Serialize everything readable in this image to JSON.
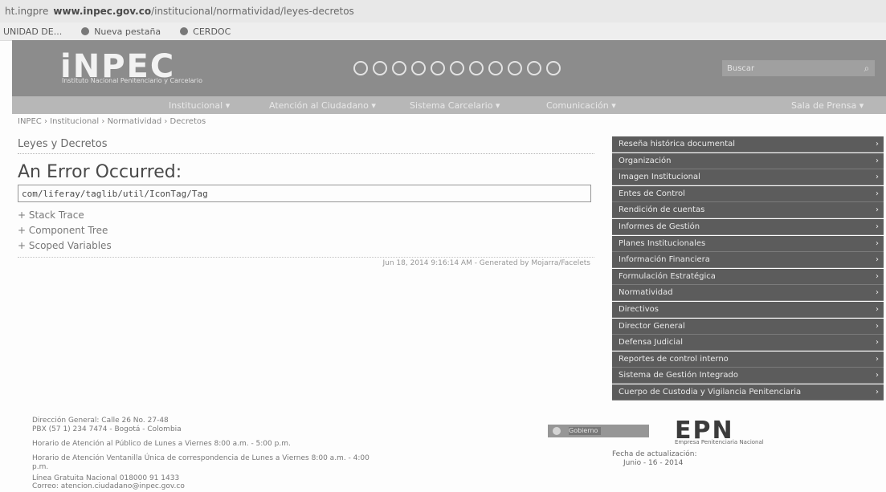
{
  "browser": {
    "url_prefix": "ht.ingpre",
    "url_domain": "www.inpec.gov.co",
    "url_path": "/institucional/normatividad/leyes-decretos"
  },
  "bookmarks": [
    {
      "label": "UNIDAD DE...",
      "icon": "globe-icon"
    },
    {
      "label": "Nueva pestaña",
      "icon": "globe-icon"
    },
    {
      "label": "CERDOC",
      "icon": "globe-icon"
    }
  ],
  "header": {
    "logo": "iNPEC",
    "logo_sub": "Instituto Nacional Penitenciario y Carcelario",
    "social_icons": [
      "circle-icon-1",
      "circle-icon-2",
      "circle-icon-3",
      "circle-icon-4",
      "circle-icon-5",
      "circle-icon-6",
      "circle-icon-7",
      "circle-icon-8",
      "circle-icon-9",
      "circle-icon-10",
      "circle-icon-11"
    ],
    "search_placeholder": "Buscar",
    "search_icon": "search-icon"
  },
  "nav": [
    {
      "label": "Institucional"
    },
    {
      "label": "Atención al Ciudadano"
    },
    {
      "label": "Sistema Carcelario"
    },
    {
      "label": "Comunicación"
    },
    {
      "label": "Sala de Prensa"
    }
  ],
  "breadcrumb": "INPEC › Institucional › Normatividad › Decretos",
  "main": {
    "section_title": "Leyes y Decretos",
    "error_title": "An Error Occurred:",
    "error_message": "com/liferay/taglib/util/IconTag/Tag",
    "toggles": [
      "+ Stack Trace",
      "+ Component Tree",
      "+ Scoped Variables"
    ],
    "version_line": "Jun 18, 2014 9:16:14 AM - Generated by Mojarra/Facelets"
  },
  "sidebar": {
    "items": [
      "Reseña histórica documental",
      "Organización",
      "Imagen Institucional",
      "Entes de Control",
      "Rendición de cuentas",
      "Informes de Gestión",
      "Planes Institucionales",
      "Información Financiera",
      "Formulación Estratégica",
      "Normatividad",
      "Directivos",
      "Director General",
      "Defensa Judicial",
      "Reportes de control interno",
      "Sistema de Gestión Integrado",
      "Cuerpo de Custodia y Vigilancia Penitenciaria"
    ]
  },
  "footer": {
    "line1": "Dirección General: Calle 26 No. 27-48",
    "line2": "PBX (57 1) 234 7474 - Bogotá - Colombia",
    "line3": "Horario de Atención al Público de Lunes a Viernes 8:00 a.m. - 5:00 p.m.",
    "line4": "Horario de Atención Ventanilla Única de correspondencia de Lunes a Viernes 8:00 a.m. - 4:00",
    "line4b": "p.m.",
    "line5": "Línea Gratuita Nacional 018000 91 1433",
    "line6": "Correo: atencion.ciudadano@inpec.gov.co",
    "gov_label": "Gobierno",
    "epn_logo": "EPN",
    "epn_sub": "Empresa Penitenciaria Nacional",
    "pub_label": "Fecha de actualización:",
    "pub_date": "Junio - 16 - 2014"
  }
}
